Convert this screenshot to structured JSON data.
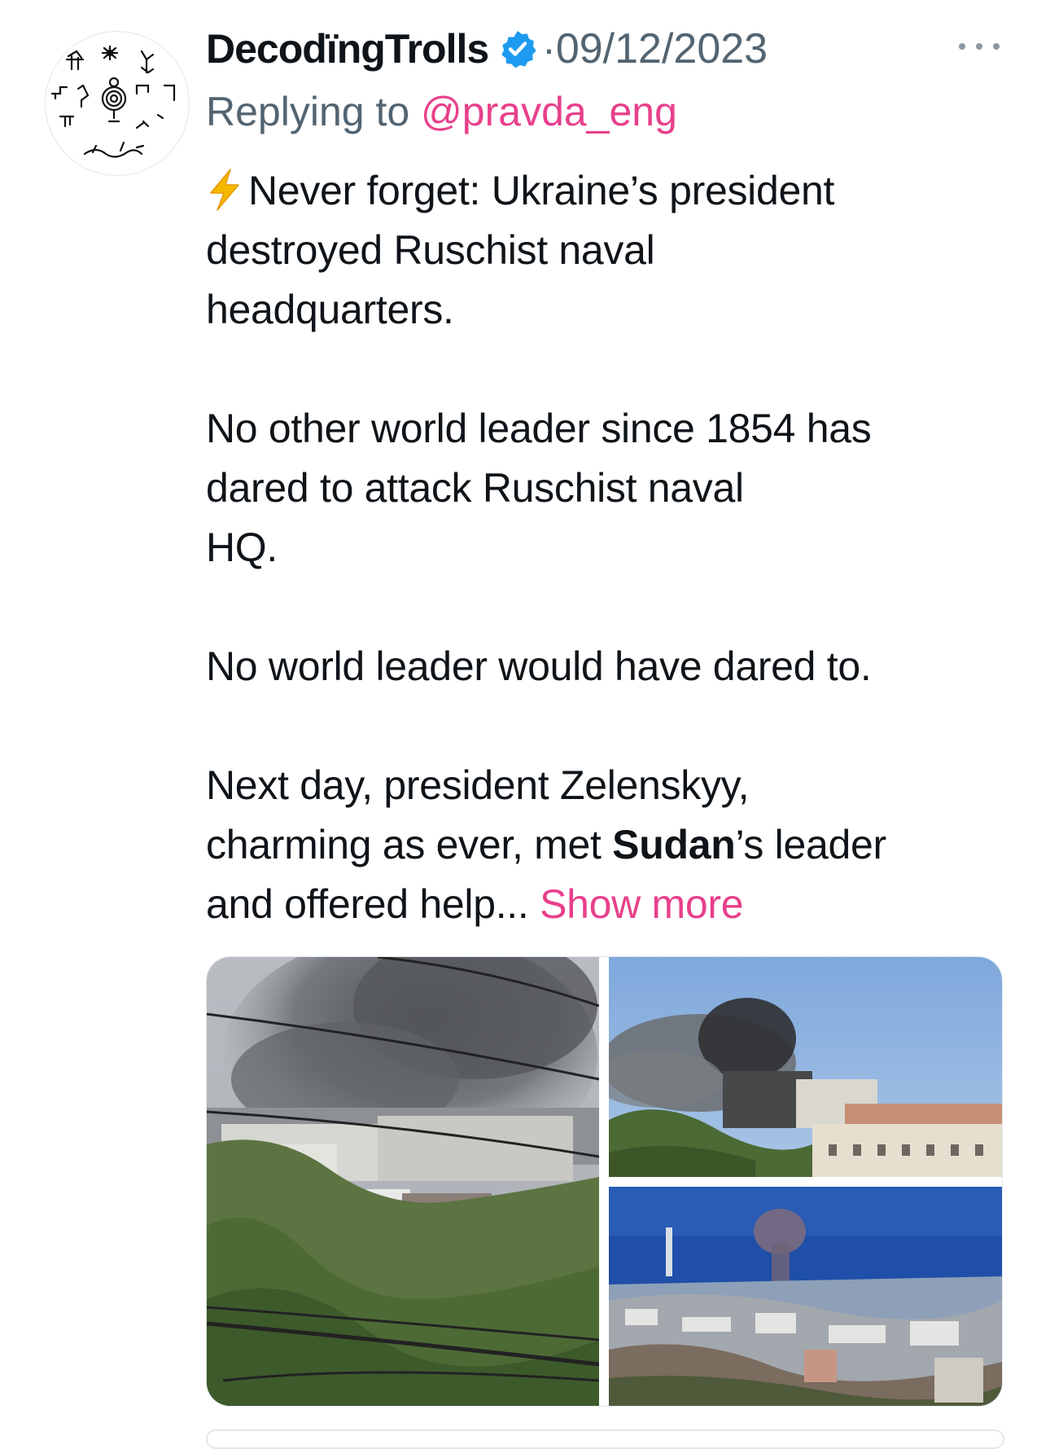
{
  "tweet": {
    "author": {
      "display_name": "DecodïngTrolls",
      "verified_icon": "verified-badge-icon",
      "avatar_icon": "petroglyph-avatar"
    },
    "separator": "·",
    "date": "09/12/2023",
    "more_icon": "more-horizontal-icon",
    "reply": {
      "prefix": "Replying to ",
      "handle": "@pravda_eng"
    },
    "text": {
      "p1_icon": "lightning-bolt-icon",
      "p1_l1": "Never forget: Ukraine’s president",
      "p1_l2": "destroyed Ruschist naval",
      "p1_l3": "headquarters.",
      "p2_l1": "No other world leader since 1854 has",
      "p2_l2": "dared to attack Ruschist naval",
      "p2_l3": "HQ.",
      "p3_l1": "No world leader would have dared to.",
      "p4_l1": "Next day, president Zelenskyy,",
      "p4_l2_a": "charming as ever, met ",
      "p4_l2_bold": "Sudan",
      "p4_l2_b": "’s leader",
      "p4_l3": "and offered help... ",
      "show_more": "Show more"
    },
    "media": [
      {
        "name": "smoke-over-building-photo"
      },
      {
        "name": "burning-naval-hq-photo"
      },
      {
        "name": "smoke-plume-over-sea-photo"
      }
    ],
    "colors": {
      "accent": "#e8408b",
      "secondary_text": "#536471",
      "verified": "#1d9bf0",
      "bolt": "#f5b800"
    }
  }
}
